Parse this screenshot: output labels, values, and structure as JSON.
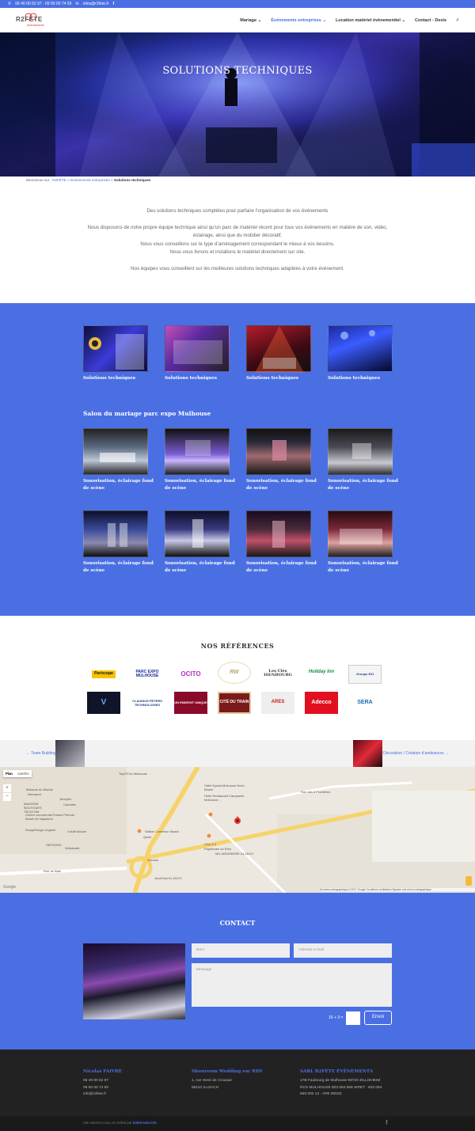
{
  "topbar": {
    "phone": "06 40 00 62 97 - 09 50 00 74 50",
    "email": "infos@r2fete.fr",
    "facebook_icon": "facebook-icon"
  },
  "header": {
    "logo_text": "R2FETE",
    "logo_sub": "événements",
    "nav": [
      {
        "label": "Mariage"
      },
      {
        "label": "Événements entreprises"
      },
      {
        "label": "Location matériel évènementiel"
      },
      {
        "label": "Contact - Devis"
      }
    ],
    "search_icon": "search-icon"
  },
  "hero": {
    "title": "SOLUTIONS TECHNIQUES"
  },
  "breadcrumb": {
    "prefix": "Bienvenue sur :",
    "home": "R2FÊTE",
    "sep1": ">",
    "parent": "Événements entreprises",
    "sep2": ">",
    "current": "Solutions techniques"
  },
  "intro": {
    "p1": "Des solutions techniques complètes pour parfaire l’organisation de vos événements",
    "p2a": "Nous disposons de notre propre équipe technique ainsi qu’un parc de matériel récent pour tous vos événements en matière de son, vidéo, éclairage, ainsi que du mobilier décoratif.",
    "p2b": "Nous vous conseillons sur le type d’aménagement correspondant le mieux à vos besoins.",
    "p2c": "Nous vous livrons et installons le matériel directement sur site.",
    "p3": "Nos équipes vous conseillent sur les meilleures solutions techniques adaptées à votre événement."
  },
  "gallery": {
    "row1": [
      {
        "caption": "Solutions techniques"
      },
      {
        "caption": "Solutions techniques"
      },
      {
        "caption": "Solutions techniques"
      },
      {
        "caption": "Solutions techniques"
      }
    ],
    "section_title": "Salon du mariage parc expo Mulhouse",
    "row2": [
      {
        "caption": "Sonorisation, éclairage fond de scène"
      },
      {
        "caption": "Sonorisation, éclairage fond de scène"
      },
      {
        "caption": "Sonorisation, éclairage fond de scène"
      },
      {
        "caption": "Sonorisation, éclairage fond de scène"
      }
    ],
    "row3": [
      {
        "caption": "Sonorisation, éclairage fond de scène"
      },
      {
        "caption": "Sonorisation, éclairage fond de scène"
      },
      {
        "caption": "Sonorisation, éclairage fond de scène"
      },
      {
        "caption": "Sonorisation, éclairage fond de scène"
      }
    ]
  },
  "references": {
    "title": "NOS RÉFÉRENCES",
    "logos": [
      {
        "name": "Periscope"
      },
      {
        "name": "PARC EXPO MULHOUSE"
      },
      {
        "name": "OCITO"
      },
      {
        "name": "RW"
      },
      {
        "name": "Les Clés ISENBOURG"
      },
      {
        "name": "Holiday Inn"
      },
      {
        "name": "Groupe EXI"
      },
      {
        "name": "V"
      },
      {
        "name": "CLAUDIUS PETERS TECHNOLOGIES"
      },
      {
        "name": "UN ENDROIT UNIQUE"
      },
      {
        "name": "CITÉ DU TRAIN"
      },
      {
        "name": "ARES"
      },
      {
        "name": "Adecco"
      },
      {
        "name": "SERA"
      }
    ]
  },
  "postnav": {
    "prev": "← Team Building",
    "next": "Décoration / Création d’ambiances →"
  },
  "map": {
    "tab_plan": "Plan",
    "tab_sat": "Satellite",
    "zoom_in": "+",
    "zoom_out": "−",
    "labels": [
      "Toys'R'Us Mulhouse",
      "Maisons du Monde",
      "Intersport",
      "Jennyfer",
      "MAGASIN BOUYGUES TELECOM",
      "Camaïeu",
      "Centre commercial France Prévost Illzach Ile Napoléon",
      "Hôtel Kyriad Mulhouse Nord - Illzach",
      "Hôtel Restaurant Campanile Mulhouse...",
      "Station Carrefour Illzach",
      "Quick",
      "Crédit Mutuel",
      "RougeGorge Lingerie",
      "SEPHORA",
      "Verbaudet",
      "Clos 3-4",
      "Papeteries du Rhin",
      "MA JARDINERIE ILLZACH",
      "Norauto",
      "JouéClub ILLZACH",
      "Rue de Bâle",
      "Rue des 3 Frontières"
    ],
    "footer": "Données cartographiques ©2017 Google   Conditions d'utilisation   Signaler une erreur cartographique",
    "google": "Google"
  },
  "contact": {
    "title": "CONTACT",
    "name_placeholder": "Nom",
    "email_placeholder": "Adresse e-mail",
    "message_placeholder": "Message",
    "captcha": "15 + 3 =",
    "submit": "Envoi"
  },
  "footer": {
    "col1_title": "Nicolas FAIVRE",
    "col1_lines": [
      "06 40 00 62 97",
      "09 50 00 74 50",
      "info@r2fete.fr"
    ],
    "col2_title": "Showroom Wedding sur RDV",
    "col2_lines": [
      "1, rue Henri de Crousaz",
      "68110 ILLZACH"
    ],
    "col3_title": "SARL R2FETE ÉVÉNEMENTS",
    "col3_lines": [
      "17B Faubourg de Mulhouse 68720 ZILLISHEIM",
      "RCS MULHOUSE 803 064 658 SIRET : 803 064",
      "658 000 13 - APE 9002Z"
    ],
    "credit_prefix": "Site internet conçu et réalisé par",
    "credit_link": "babel-web.info",
    "facebook_icon": "facebook-icon"
  },
  "colors": {
    "accent": "#4a6fe3",
    "footer_bg": "#222222"
  }
}
